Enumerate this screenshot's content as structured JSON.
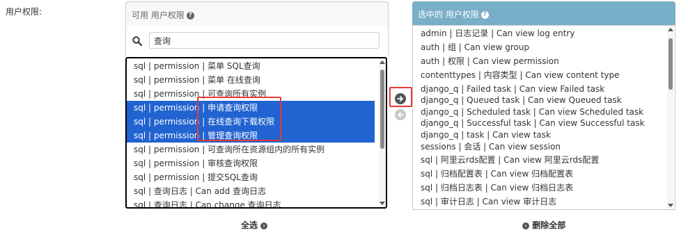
{
  "field": {
    "label": "用户权限:"
  },
  "available": {
    "title": "可用 用户权限",
    "search_value": "查询",
    "items": [
      "sql | permission | 菜单 SQL查询",
      "sql | permission | 菜单 在线查询",
      "sql | permission | 可查询所有实例",
      "sql | permission | 申请查询权限",
      "sql | permission | 在线查询下载权限",
      "sql | permission | 管理查询权限",
      "sql | permission | 可查询所在资源组内的所有实例",
      "sql | permission | 审核查询权限",
      "sql | permission | 提交SQL查询",
      "sql | 查询日志 | Can add 查询日志",
      "sql | 查询日志 | Can change 查询日志"
    ],
    "selected_indices": [
      3,
      4,
      5
    ],
    "choose_all_label": "全选"
  },
  "chosen": {
    "title": "选中的 用户权限",
    "items": [
      "admin | 日志记录 | Can view log entry",
      "auth | 组 | Can view group",
      "auth | 权限 | Can view permission",
      "contenttypes | 内容类型 | Can view content type",
      "django_q | Failed task | Can view Failed task",
      "django_q | Queued task | Can view Queued task",
      "django_q | Scheduled task | Can view Scheduled task",
      "django_q | Successful task | Can view Successful task",
      "django_q | task | Can view task",
      "sessions | 会话 | Can view session",
      "sql | 阿里云rds配置 | Can view 阿里云rds配置",
      "sql | 归档配置表 | Can view 归档配置表",
      "sql | 归档日志表 | Can view 归档日志表",
      "sql | 审计日志 | Can view 审计日志"
    ],
    "remove_all_label": "删除全部"
  },
  "icons": {
    "help": "help-icon",
    "search": "search-icon",
    "choose": "arrow-right-circle-icon",
    "remove": "arrow-left-circle-icon"
  },
  "colors": {
    "selected_bg": "#2163d0",
    "chosen_header": "#79aec8",
    "highlight_box": "#e53935"
  }
}
